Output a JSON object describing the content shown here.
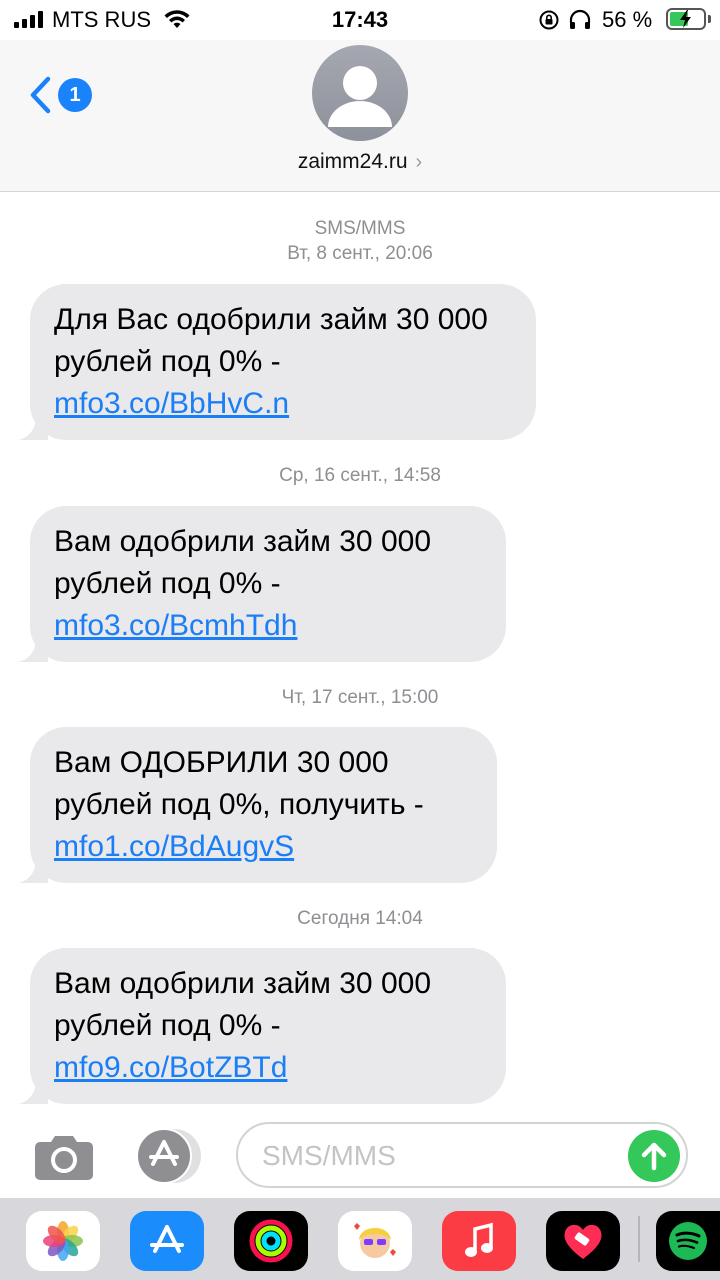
{
  "status_bar": {
    "carrier": "MTS RUS",
    "time": "17:43",
    "battery_percent": "56 %",
    "battery_level": 0.56,
    "icons": [
      "signal-icon",
      "wifi-icon",
      "rotation-lock-icon",
      "headphones-icon",
      "battery-charging-icon"
    ]
  },
  "header": {
    "back_badge": "1",
    "contact_name": "zaimm24.ru",
    "icons": [
      "back-chevron-icon",
      "avatar-person-icon",
      "chevron-right-icon"
    ]
  },
  "conversation": {
    "service_label": "SMS/MMS",
    "groups": [
      {
        "timestamp": "Вт, 8 сент., 20:06",
        "text_before": "Для Вас одобрили займ 30 000 рублей под 0% - ",
        "link": "mfo3.co/BbHvC.n"
      },
      {
        "timestamp": "Ср, 16 сент., 14:58",
        "text_before": "Вам одобрили займ 30 000 рублей под 0% - ",
        "link": "mfo3.co/BcmhTdh"
      },
      {
        "timestamp": "Чт, 17 сент., 15:00",
        "text_before": "Вам ОДОБРИЛИ 30 000 рублей под 0%, получить - ",
        "link": "mfo1.co/BdAugvS"
      },
      {
        "timestamp": "Сегодня 14:04",
        "text_before": "Вам одобрили займ 30 000 рублей под 0% - ",
        "link": "mfo9.co/BotZBTd"
      }
    ]
  },
  "composer": {
    "placeholder": "SMS/MMS",
    "value": "",
    "icons": [
      "camera-icon",
      "app-store-icon",
      "send-arrow-icon"
    ]
  },
  "app_drawer": {
    "apps": [
      {
        "name": "photos-app-icon",
        "color": "#ffffff"
      },
      {
        "name": "app-store-app-icon",
        "color": "#1a8cfb"
      },
      {
        "name": "activity-app-icon",
        "color": "#000000"
      },
      {
        "name": "memoji-app-icon",
        "color": "#ffffff"
      },
      {
        "name": "music-app-icon",
        "color": "#fc3c44"
      },
      {
        "name": "heart-app-icon",
        "color": "#000000"
      },
      {
        "name": "spotify-app-icon",
        "color": "#000000"
      }
    ]
  },
  "colors": {
    "ios_blue": "#1a82fb",
    "bubble_gray": "#e9e9eb",
    "send_green": "#34c759",
    "meta_gray": "#8e8e93"
  }
}
